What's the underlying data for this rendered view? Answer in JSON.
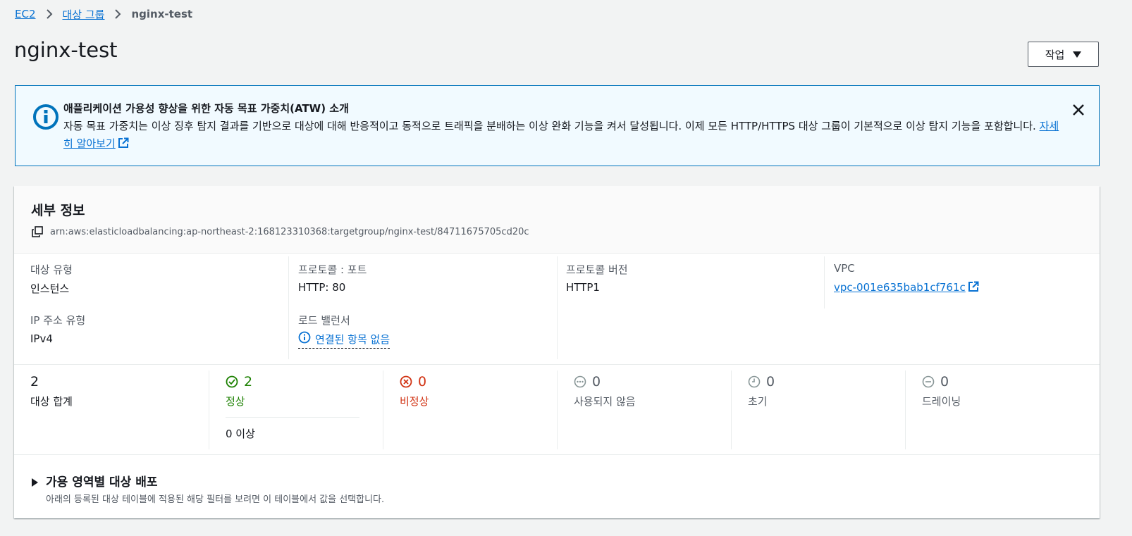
{
  "breadcrumb": {
    "items": [
      "EC2",
      "대상 그룹"
    ],
    "current": "nginx-test"
  },
  "page": {
    "title": "nginx-test",
    "action_button": "작업"
  },
  "banner": {
    "title": "애플리케이션 가용성 향상을 위한 자동 목표 가중치(ATW) 소개",
    "body": "자동 목표 가중치는 이상 징후 탐지 결과를 기반으로 대상에 대해 반응적이고 동적으로 트래픽을 분배하는 이상 완화 기능을 켜서 달성됩니다. 이제 모든 HTTP/HTTPS 대상 그룹이 기본적으로 이상 탐지 기능을 포함합니다.",
    "link": "자세히 알아보기"
  },
  "details": {
    "title": "세부 정보",
    "arn": "arn:aws:elasticloadbalancing:ap-northeast-2:168123310368:targetgroup/nginx-test/84711675705cd20c",
    "target_type_label": "대상 유형",
    "target_type_value": "인스턴스",
    "ip_type_label": "IP 주소 유형",
    "ip_type_value": "IPv4",
    "protocol_port_label": "프로토콜 : 포트",
    "protocol_port_value": "HTTP: 80",
    "load_balancer_label": "로드 밸런서",
    "load_balancer_value": "연결된 항목 없음",
    "protocol_version_label": "프로토콜 버전",
    "protocol_version_value": "HTTP1",
    "vpc_label": "VPC",
    "vpc_value": "vpc-001e635bab1cf761c"
  },
  "stats": {
    "total": {
      "value": "2",
      "label": "대상 합계"
    },
    "healthy": {
      "value": "2",
      "label": "정상",
      "sub": "0 이상"
    },
    "unhealthy": {
      "value": "0",
      "label": "비정상"
    },
    "unused": {
      "value": "0",
      "label": "사용되지 않음"
    },
    "initial": {
      "value": "0",
      "label": "초기"
    },
    "draining": {
      "value": "0",
      "label": "드레이닝"
    }
  },
  "az_section": {
    "title": "가용 영역별 대상 배포",
    "description": "아래의 등록된 대상 테이블에 적용된 해당 필터를 보려면 이 테이블에서 값을 선택합니다."
  },
  "colors": {
    "link": "#0972d3",
    "healthy": "#1d8102",
    "unhealthy": "#d13212",
    "banner_border": "#0073bb",
    "banner_bg": "#f1faff"
  }
}
